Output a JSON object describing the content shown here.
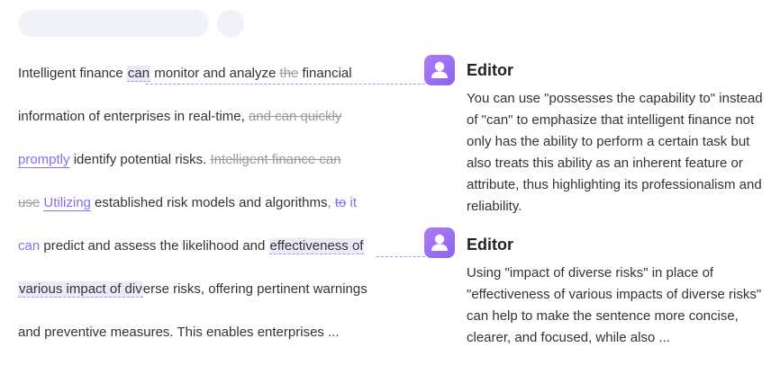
{
  "document": {
    "lines": [
      [
        {
          "t": "Intelligent finance "
        },
        {
          "t": "can",
          "cls": "hl"
        },
        {
          "t": " monitor and analyze "
        },
        {
          "t": "the",
          "cls": "del"
        },
        {
          "t": " financial"
        }
      ],
      [
        {
          "t": "information of enterprises in real-time, "
        },
        {
          "t": "and can quickly",
          "cls": "del"
        }
      ],
      [
        {
          "t": "promptly",
          "cls": "ins"
        },
        {
          "t": " identify potential risks. "
        },
        {
          "t": "Intelligent finance can",
          "cls": "del"
        }
      ],
      [
        {
          "t": "use",
          "cls": "del"
        },
        {
          "t": " "
        },
        {
          "t": "Utilizing",
          "cls": "ins"
        },
        {
          "t": " established risk models and algorithms"
        },
        {
          "t": ", ",
          "cls": "purple"
        },
        {
          "t": "to",
          "cls": "del purple"
        },
        {
          "t": " it",
          "cls": "purple"
        }
      ],
      [
        {
          "t": "can",
          "cls": "purple"
        },
        {
          "t": " predict and assess the likelihood and "
        },
        {
          "t": "effectiveness of",
          "cls": "hl"
        }
      ],
      [
        {
          "t": "various impact of div",
          "cls": "hl"
        },
        {
          "t": "erse risks, offering pertinent warnings"
        }
      ],
      [
        {
          "t": "and preventive measures. This enables enterprises  ..."
        }
      ]
    ]
  },
  "suggestions": [
    {
      "title": "Editor",
      "icon": "user-icon",
      "body": "You can use \"possesses the capability to\" instead of \"can\" to emphasize that intelligent finance not only has the ability to perform a certain task but also treats this ability as an inherent feature or attribute, thus highlighting its professionalism and reliability."
    },
    {
      "title": "Editor",
      "icon": "user-icon",
      "body": "Using \"impact of diverse risks\" in place of \"effectiveness of various impacts of diverse risks\" can help to make the sentence more concise, clearer, and focused, while also ..."
    }
  ],
  "colors": {
    "accent": "#8b6cf0",
    "highlight": "#ece9fb",
    "deleted": "#9a9a9a",
    "skeleton": "#f1f2fa"
  }
}
